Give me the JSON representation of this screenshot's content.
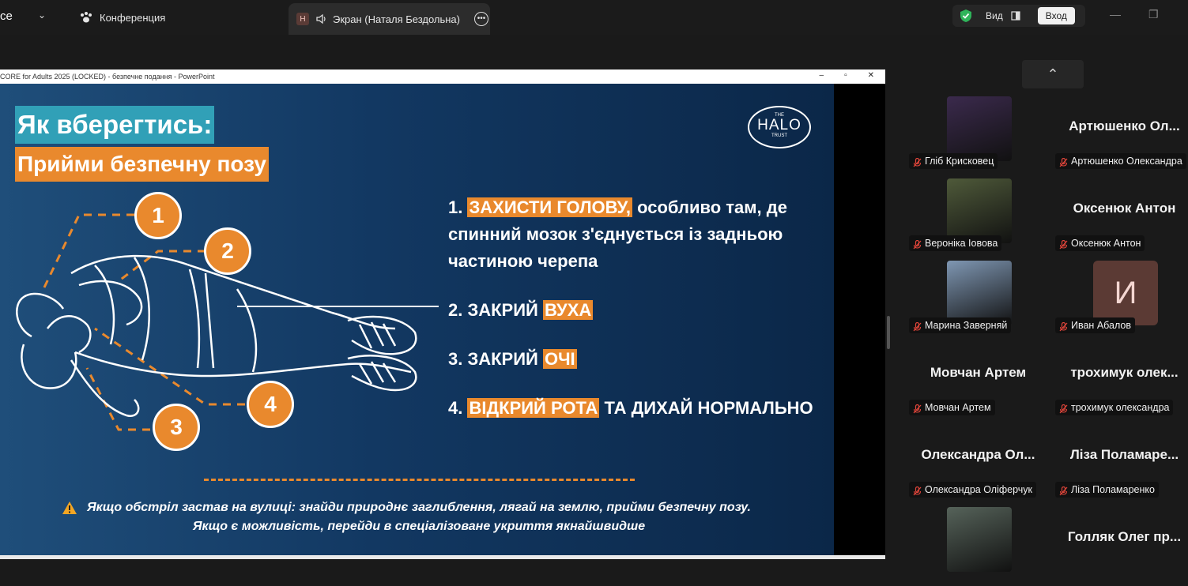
{
  "topbar": {
    "app_fragment": "ce",
    "conference_label": "Конференция",
    "tab_badge": "Н",
    "tab_label": "Экран (Наталя Бездольна)",
    "view_label": "Вид",
    "login_label": "Вход"
  },
  "powerpoint": {
    "window_title": "CORE for Adults 2025 (LOCKED)  -  безпечне подання - PowerPoint",
    "minimize": "–",
    "restore": "▫",
    "close": "✕"
  },
  "slide": {
    "title1": "Як вберегтись:",
    "title2": "Прийми безпечну позу",
    "logo_small_top": "THE",
    "logo_main": "HALO",
    "logo_small_bottom": "TRUST",
    "badges": [
      "1",
      "2",
      "3",
      "4"
    ],
    "steps": [
      {
        "prefix": "1. ",
        "highlight": "ЗАХИСТИ ГОЛОВУ,",
        "rest": " особливо там, де спинний мозок з'єднується із задньою частиною черепа"
      },
      {
        "prefix": "2. ЗАКРИЙ ",
        "highlight": "ВУХА",
        "rest": ""
      },
      {
        "prefix": "3. ЗАКРИЙ ",
        "highlight": "ОЧІ",
        "rest": ""
      },
      {
        "prefix": "4. ",
        "highlight": "ВІДКРИЙ РОТА",
        "rest": " ТА ДИХАЙ НОРМАЛЬНО"
      }
    ],
    "warning_line1": "Якщо обстріл застав на вулиці: знайди природнє заглиблення, лягай на землю, прийми безпечну позу.",
    "warning_line2": "Якщо є можливість, перейди в спеціалізоване укриття якнайшвидше"
  },
  "participants": [
    {
      "name": "Гліб Крисковец",
      "big": "",
      "kind": "photo",
      "color": "#3b2a4d"
    },
    {
      "name": "Артюшенко Олександра",
      "big": "Артюшенко Ол...",
      "kind": "none",
      "color": ""
    },
    {
      "name": "Вероніка Іовова",
      "big": "",
      "kind": "photo",
      "color": "#4f5a3a"
    },
    {
      "name": "Оксенюк Антон",
      "big": "Оксенюк Антон",
      "kind": "none",
      "color": ""
    },
    {
      "name": "Марина Заверняй",
      "big": "",
      "kind": "photo",
      "color": "#7f97b3"
    },
    {
      "name": "Иван Абалов",
      "big": "",
      "kind": "initial",
      "initial": "И",
      "color": "#5b3a34"
    },
    {
      "name": "Мовчан Артем",
      "big": "Мовчан Артем",
      "kind": "none",
      "color": ""
    },
    {
      "name": "трохимук олександра",
      "big": "трохимук олек...",
      "kind": "none",
      "color": ""
    },
    {
      "name": "Олександра Оліферчук",
      "big": "Олександра Ол...",
      "kind": "none",
      "color": ""
    },
    {
      "name": "Ліза Поламаренко",
      "big": "Ліза Поламаре...",
      "kind": "none",
      "color": ""
    },
    {
      "name": "",
      "big": "",
      "kind": "photo",
      "color": "#56635a"
    },
    {
      "name": "",
      "big": "Голляк Олег пр...",
      "kind": "none",
      "color": ""
    }
  ],
  "colors": {
    "accent_orange": "#e9892d",
    "accent_teal": "#31a0b7",
    "slide_bg": "#123862",
    "mic_muted": "#e0453a",
    "shield_green": "#2fb45a"
  }
}
